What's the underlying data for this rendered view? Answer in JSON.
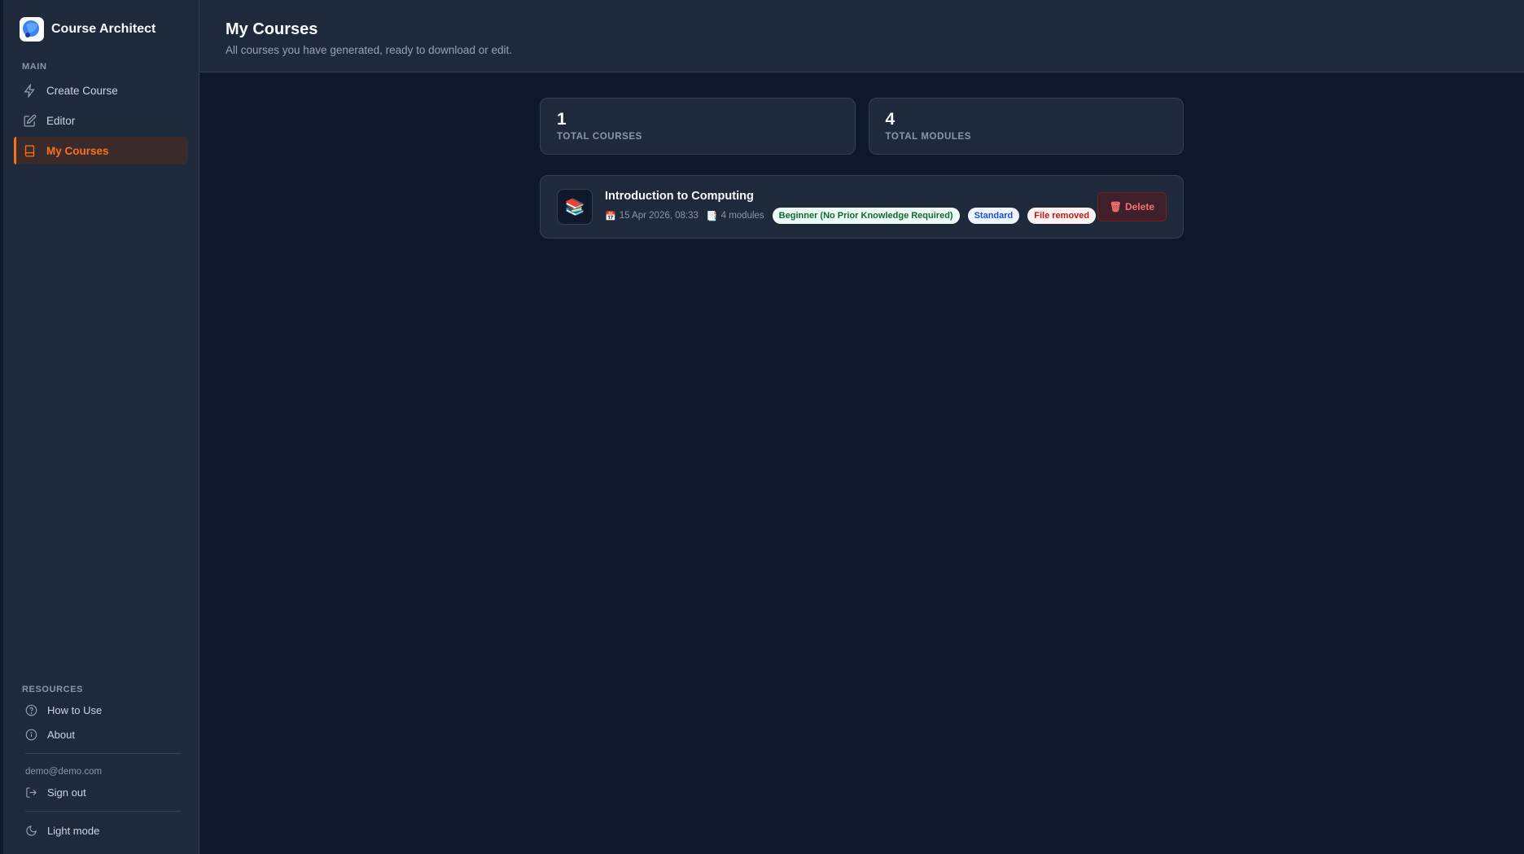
{
  "app": {
    "name": "Course Architect"
  },
  "sidebar": {
    "main_label": "MAIN",
    "items": [
      {
        "label": "Create Course",
        "icon": "bolt-icon"
      },
      {
        "label": "Editor",
        "icon": "edit-icon"
      },
      {
        "label": "My Courses",
        "icon": "book-icon",
        "active": true
      }
    ],
    "resources_label": "RESOURCES",
    "resources": [
      {
        "label": "How to Use",
        "icon": "help-circle-icon"
      },
      {
        "label": "About",
        "icon": "info-icon"
      }
    ],
    "user_email": "demo@demo.com",
    "sign_out": "Sign out",
    "theme_toggle": "Light mode"
  },
  "header": {
    "title": "My Courses",
    "subtitle": "All courses you have generated, ready to download or edit."
  },
  "stats": [
    {
      "value": "1",
      "label": "TOTAL COURSES"
    },
    {
      "value": "4",
      "label": "TOTAL MODULES"
    }
  ],
  "courses": [
    {
      "title": "Introduction to Computing",
      "date": "15 Apr 2026, 08:33",
      "modules": "4 modules",
      "level": "Beginner (No Prior Knowledge Required)",
      "type": "Standard",
      "status": "File removed",
      "delete_label": "Delete"
    }
  ],
  "colors": {
    "accent": "#f97316",
    "background": "#0f172a",
    "surface": "#1e293b"
  }
}
